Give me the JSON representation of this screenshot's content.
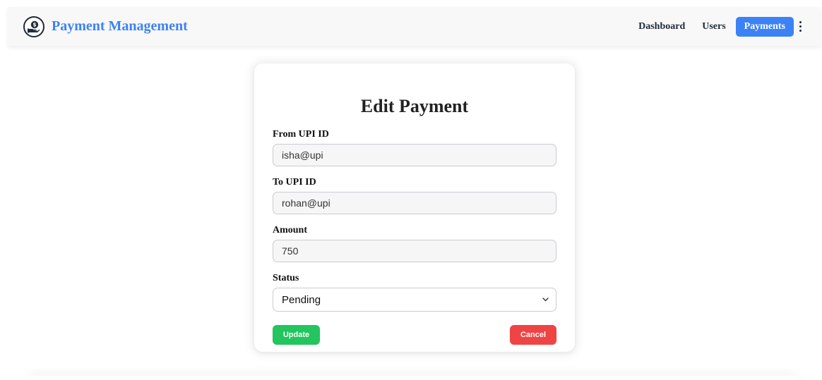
{
  "navbar": {
    "brand_icon": "money-hand-icon",
    "brand_title": "Payment Management",
    "links": [
      {
        "label": "Dashboard",
        "active": false
      },
      {
        "label": "Users",
        "active": false
      },
      {
        "label": "Payments",
        "active": true
      }
    ],
    "more_icon": "kebab-menu-icon",
    "active_color": "#3b82f6"
  },
  "form": {
    "title": "Edit Payment",
    "from_upi": {
      "label": "From UPI ID",
      "value": "isha@upi"
    },
    "to_upi": {
      "label": "To UPI ID",
      "value": "rohan@upi"
    },
    "amount": {
      "label": "Amount",
      "value": "750"
    },
    "status": {
      "label": "Status",
      "value": "Pending",
      "icon": "chevron-down-icon"
    },
    "update_label": "Update",
    "cancel_label": "Cancel",
    "update_color": "#22c55e",
    "cancel_color": "#ef4444"
  }
}
